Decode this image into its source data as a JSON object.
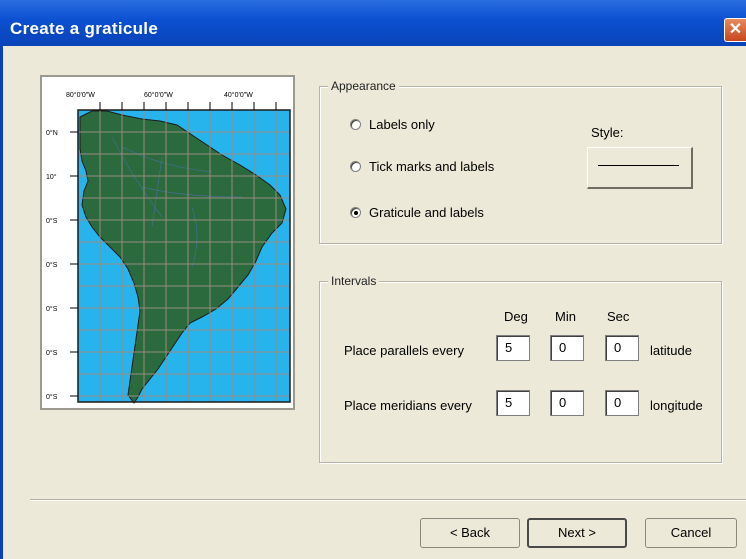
{
  "window": {
    "title": "Create a graticule",
    "close_glyph": "✕"
  },
  "map": {
    "top_labels": [
      "80°0'0\"W",
      "60°0'0\"W",
      "40°0'0\"W"
    ],
    "left_labels": [
      "0°N",
      "10°",
      "0°S",
      "0°S",
      "0°S",
      "0°S",
      "0°S"
    ],
    "colors": {
      "ocean": "#27b4ec",
      "land": "#2b6a3c",
      "grid": "#9a8a7e",
      "border": "#1b1b1b"
    }
  },
  "appearance": {
    "legend": "Appearance",
    "options": [
      {
        "label": "Labels only",
        "checked": false
      },
      {
        "label": "Tick marks and labels",
        "checked": false
      },
      {
        "label": "Graticule and labels",
        "checked": true
      }
    ],
    "style_label": "Style:"
  },
  "intervals": {
    "legend": "Intervals",
    "headers": {
      "deg": "Deg",
      "min": "Min",
      "sec": "Sec"
    },
    "parallels": {
      "label": "Place parallels every",
      "deg": "5",
      "min": "0",
      "sec": "0",
      "unit": "latitude"
    },
    "meridians": {
      "label": "Place meridians every",
      "deg": "5",
      "min": "0",
      "sec": "0",
      "unit": "longitude"
    }
  },
  "buttons": {
    "back": "< Back",
    "next": "Next >",
    "cancel": "Cancel"
  }
}
